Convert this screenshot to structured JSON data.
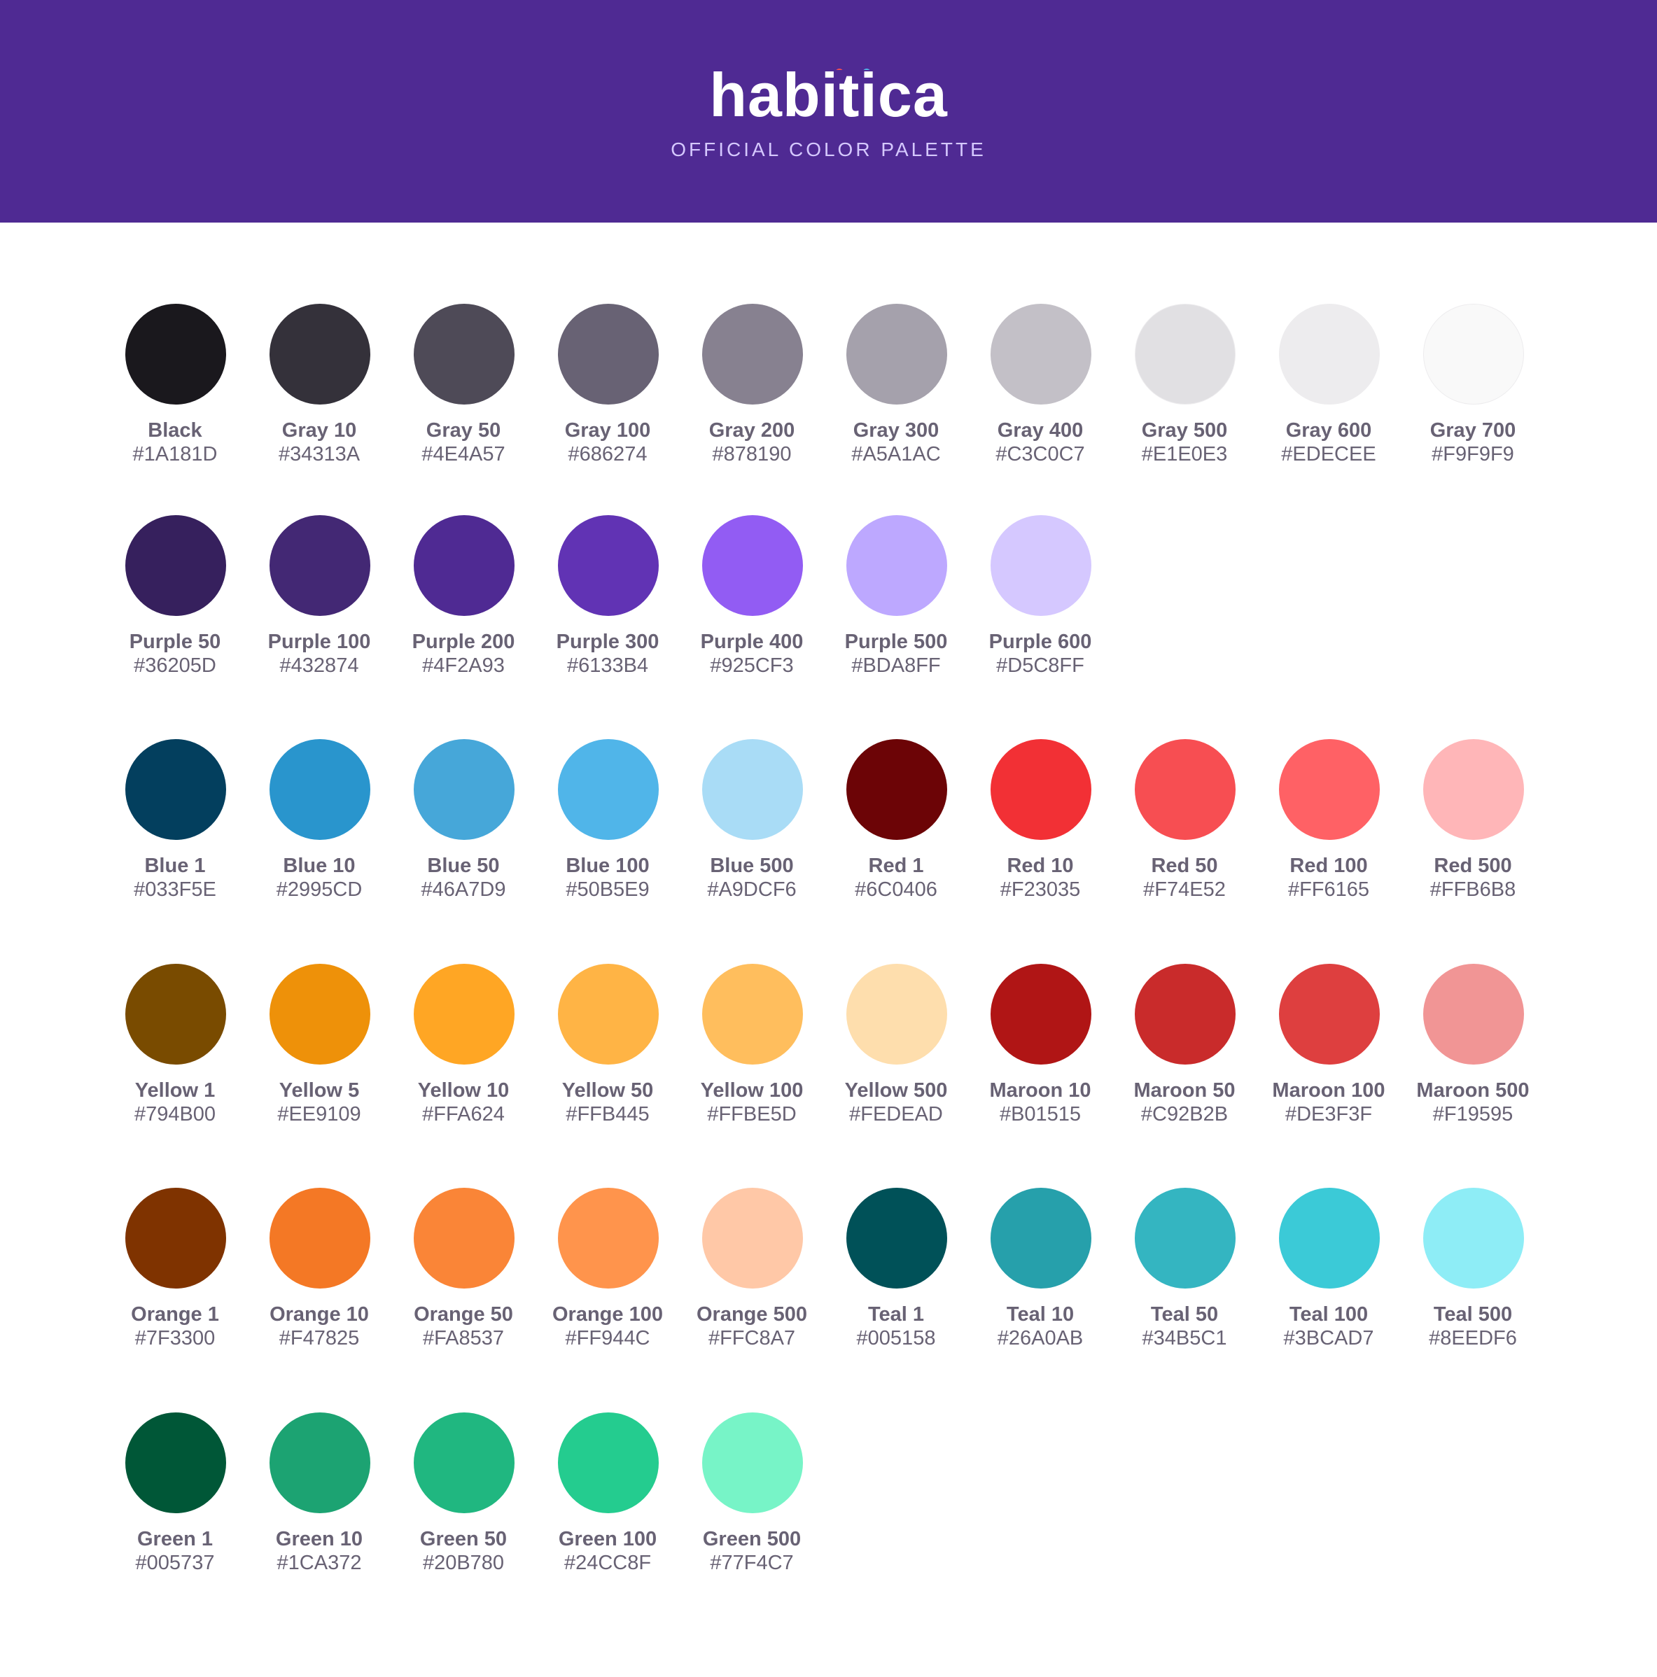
{
  "header": {
    "logo": "habitica",
    "subtitle": "OFFICIAL COLOR PALETTE",
    "background": "#4F2A93",
    "logo_dot_colors": [
      "#F74E52",
      "#50B5E9"
    ]
  },
  "palette": [
    [
      {
        "name": "Black",
        "hex": "#1A181D"
      },
      {
        "name": "Gray 10",
        "hex": "#34313A"
      },
      {
        "name": "Gray 50",
        "hex": "#4E4A57"
      },
      {
        "name": "Gray 100",
        "hex": "#686274"
      },
      {
        "name": "Gray 200",
        "hex": "#878190"
      },
      {
        "name": "Gray 300",
        "hex": "#A5A1AC"
      },
      {
        "name": "Gray 400",
        "hex": "#C3C0C7"
      },
      {
        "name": "Gray 500",
        "hex": "#E1E0E3"
      },
      {
        "name": "Gray 600",
        "hex": "#EDECEE"
      },
      {
        "name": "Gray 700",
        "hex": "#F9F9F9"
      }
    ],
    [
      {
        "name": "Purple 50",
        "hex": "#36205D"
      },
      {
        "name": "Purple 100",
        "hex": "#432874"
      },
      {
        "name": "Purple 200",
        "hex": "#4F2A93"
      },
      {
        "name": "Purple 300",
        "hex": "#6133B4"
      },
      {
        "name": "Purple 400",
        "hex": "#925CF3"
      },
      {
        "name": "Purple 500",
        "hex": "#BDA8FF"
      },
      {
        "name": "Purple 600",
        "hex": "#D5C8FF"
      }
    ],
    [
      {
        "name": "Blue 1",
        "hex": "#033F5E"
      },
      {
        "name": "Blue 10",
        "hex": "#2995CD"
      },
      {
        "name": "Blue 50",
        "hex": "#46A7D9"
      },
      {
        "name": "Blue 100",
        "hex": "#50B5E9"
      },
      {
        "name": "Blue 500",
        "hex": "#A9DCF6"
      },
      {
        "name": "Red 1",
        "hex": "#6C0406"
      },
      {
        "name": "Red 10",
        "hex": "#F23035"
      },
      {
        "name": "Red 50",
        "hex": "#F74E52"
      },
      {
        "name": "Red 100",
        "hex": "#FF6165"
      },
      {
        "name": "Red 500",
        "hex": "#FFB6B8"
      }
    ],
    [
      {
        "name": "Yellow 1",
        "hex": "#794B00"
      },
      {
        "name": "Yellow 5",
        "hex": "#EE9109"
      },
      {
        "name": "Yellow 10",
        "hex": "#FFA624"
      },
      {
        "name": "Yellow 50",
        "hex": "#FFB445"
      },
      {
        "name": "Yellow 100",
        "hex": "#FFBE5D"
      },
      {
        "name": "Yellow 500",
        "hex": "#FEDEAD"
      },
      {
        "name": "Maroon 10",
        "hex": "#B01515"
      },
      {
        "name": "Maroon 50",
        "hex": "#C92B2B"
      },
      {
        "name": "Maroon 100",
        "hex": "#DE3F3F"
      },
      {
        "name": "Maroon 500",
        "hex": "#F19595"
      }
    ],
    [
      {
        "name": "Orange 1",
        "hex": "#7F3300"
      },
      {
        "name": "Orange 10",
        "hex": "#F47825"
      },
      {
        "name": "Orange 50",
        "hex": "#FA8537"
      },
      {
        "name": "Orange 100",
        "hex": "#FF944C"
      },
      {
        "name": "Orange 500",
        "hex": "#FFC8A7"
      },
      {
        "name": "Teal 1",
        "hex": "#005158"
      },
      {
        "name": "Teal 10",
        "hex": "#26A0AB"
      },
      {
        "name": "Teal 50",
        "hex": "#34B5C1"
      },
      {
        "name": "Teal 100",
        "hex": "#3BCAD7"
      },
      {
        "name": "Teal 500",
        "hex": "#8EEDF6"
      }
    ],
    [
      {
        "name": "Green 1",
        "hex": "#005737"
      },
      {
        "name": "Green 10",
        "hex": "#1CA372"
      },
      {
        "name": "Green 50",
        "hex": "#20B780"
      },
      {
        "name": "Green 100",
        "hex": "#24CC8F"
      },
      {
        "name": "Green 500",
        "hex": "#77F4C7"
      }
    ]
  ]
}
